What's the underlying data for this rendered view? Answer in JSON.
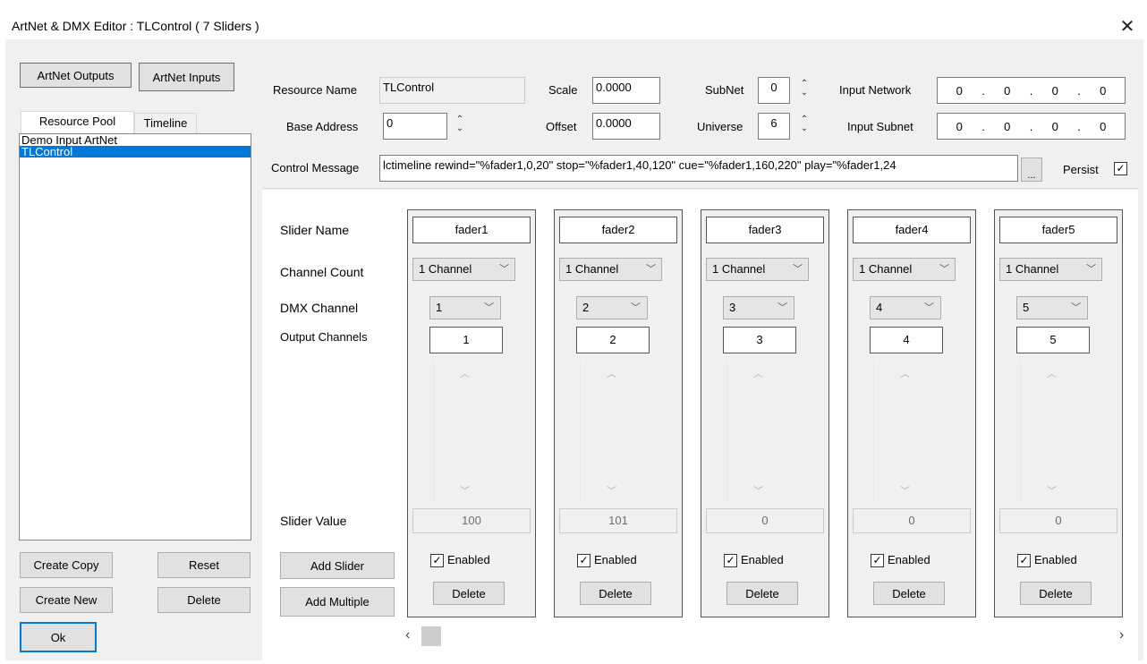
{
  "window": {
    "title": "ArtNet & DMX Editor : TLControl ( 7 Sliders )",
    "close_glyph": "✕"
  },
  "left": {
    "artnet_outputs_label": "ArtNet Outputs",
    "artnet_inputs_label": "ArtNet Inputs",
    "tabs": [
      "Resource Pool",
      "Timeline"
    ],
    "list_items": [
      "Demo Input ArtNet",
      "TLControl"
    ],
    "selected_item": "TLControl",
    "create_copy_label": "Create Copy",
    "reset_label": "Reset",
    "create_new_label": "Create New",
    "delete_label": "Delete",
    "ok_label": "Ok"
  },
  "props": {
    "resource_name_label": "Resource Name",
    "resource_name_value": "TLControl",
    "base_address_label": "Base Address",
    "base_address_value": "0",
    "scale_label": "Scale",
    "scale_value": "0.0000",
    "offset_label": "Offset",
    "offset_value": "0.0000",
    "subnet_label": "SubNet",
    "subnet_value": "0",
    "universe_label": "Universe",
    "universe_value": "6",
    "input_network_label": "Input Network",
    "input_network_octets": [
      "0",
      "0",
      "0",
      "0"
    ],
    "input_subnet_label": "Input Subnet",
    "input_subnet_octets": [
      "0",
      "0",
      "0",
      "0"
    ],
    "control_message_label": "Control Message",
    "control_message_value": "lctimeline rewind=\"%fader1,0,20\" stop=\"%fader1,40,120\" cue=\"%fader1,160,220\" play=\"%fader1,24",
    "browse_label": "...",
    "persist_label": "Persist",
    "persist_checked": true
  },
  "sliders_panel": {
    "row_labels": {
      "slider_name": "Slider Name",
      "channel_count": "Channel Count",
      "dmx_channel": "DMX Channel",
      "output_channels": "Output Channels",
      "slider_value": "Slider Value"
    },
    "add_slider_label": "Add Slider",
    "add_multiple_label": "Add Multiple",
    "sliders": [
      {
        "name": "fader1",
        "channel_count": "1 Channel",
        "dmx_channel": "1",
        "output_channels": "1",
        "value": "100",
        "enabled": true,
        "enabled_label": "Enabled",
        "delete_label": "Delete"
      },
      {
        "name": "fader2",
        "channel_count": "1 Channel",
        "dmx_channel": "2",
        "output_channels": "2",
        "value": "101",
        "enabled": true,
        "enabled_label": "Enabled",
        "delete_label": "Delete"
      },
      {
        "name": "fader3",
        "channel_count": "1 Channel",
        "dmx_channel": "3",
        "output_channels": "3",
        "value": "0",
        "enabled": true,
        "enabled_label": "Enabled",
        "delete_label": "Delete"
      },
      {
        "name": "fader4",
        "channel_count": "1 Channel",
        "dmx_channel": "4",
        "output_channels": "4",
        "value": "0",
        "enabled": true,
        "enabled_label": "Enabled",
        "delete_label": "Delete"
      },
      {
        "name": "fader5",
        "channel_count": "1 Channel",
        "dmx_channel": "5",
        "output_channels": "5",
        "value": "0",
        "enabled": true,
        "enabled_label": "Enabled",
        "delete_label": "Delete"
      }
    ]
  },
  "icons": {
    "checkmark": "✓",
    "dropdown": "chevron-down-icon",
    "spin": "up-down-spinner-icon",
    "scroll_left": "‹",
    "scroll_right": "›"
  },
  "colors": {
    "selection": "#0078d7",
    "window_bg": "#f0f0f0"
  }
}
